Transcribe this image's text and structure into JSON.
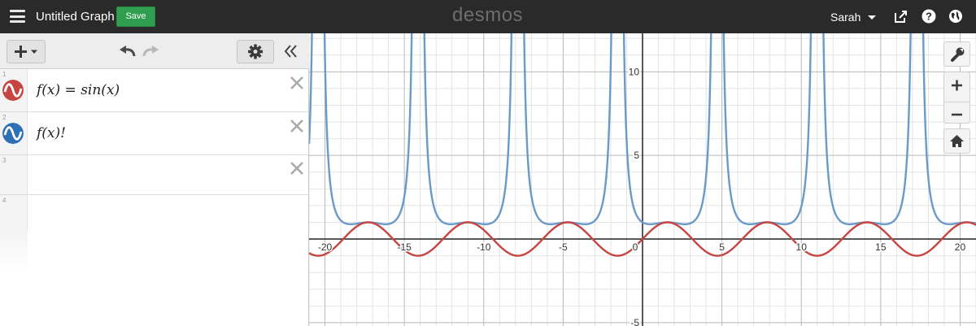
{
  "topbar": {
    "title": "Untitled Graph",
    "save_label": "Save",
    "brand": "desmos",
    "user_name": "Sarah",
    "icons": [
      "menu-icon",
      "share-icon",
      "help-icon",
      "globe-icon"
    ]
  },
  "toolbar": {
    "icons": [
      "add-icon",
      "undo-icon",
      "redo-icon",
      "gear-icon",
      "collapse-icon"
    ]
  },
  "expressions": [
    {
      "number": "1",
      "latex_display": "f(x) = sin(x)",
      "color": "#c74440",
      "icon": "sine-wave-icon"
    },
    {
      "number": "2",
      "latex_display": "f(x)!",
      "color": "#2d70b3",
      "icon": "sine-wave-icon"
    },
    {
      "number": "3",
      "latex_display": "",
      "color": "",
      "icon": ""
    },
    {
      "number": "4",
      "latex_display": "",
      "color": "",
      "icon": ""
    }
  ],
  "graph_controls": {
    "icons": [
      "wrench-icon",
      "zoom-in-icon",
      "zoom-out-icon",
      "home-icon"
    ]
  },
  "chart_data": {
    "type": "line",
    "x_range": [
      -21,
      21
    ],
    "y_range": [
      -5.2,
      12.3
    ],
    "x_tick_labels": [
      "-20",
      "-15",
      "-10",
      "-5",
      "0",
      "5",
      "10",
      "15",
      "20"
    ],
    "y_tick_labels": [
      "10",
      "5",
      "-5"
    ],
    "grid": true,
    "series": [
      {
        "name": "f(x) = sin(x)",
        "function": "sin(x)",
        "color": "#c74440"
      },
      {
        "name": "f(x)!",
        "function": "gamma(sin(x) + 1)",
        "color": "#6a9bc8"
      }
    ]
  }
}
